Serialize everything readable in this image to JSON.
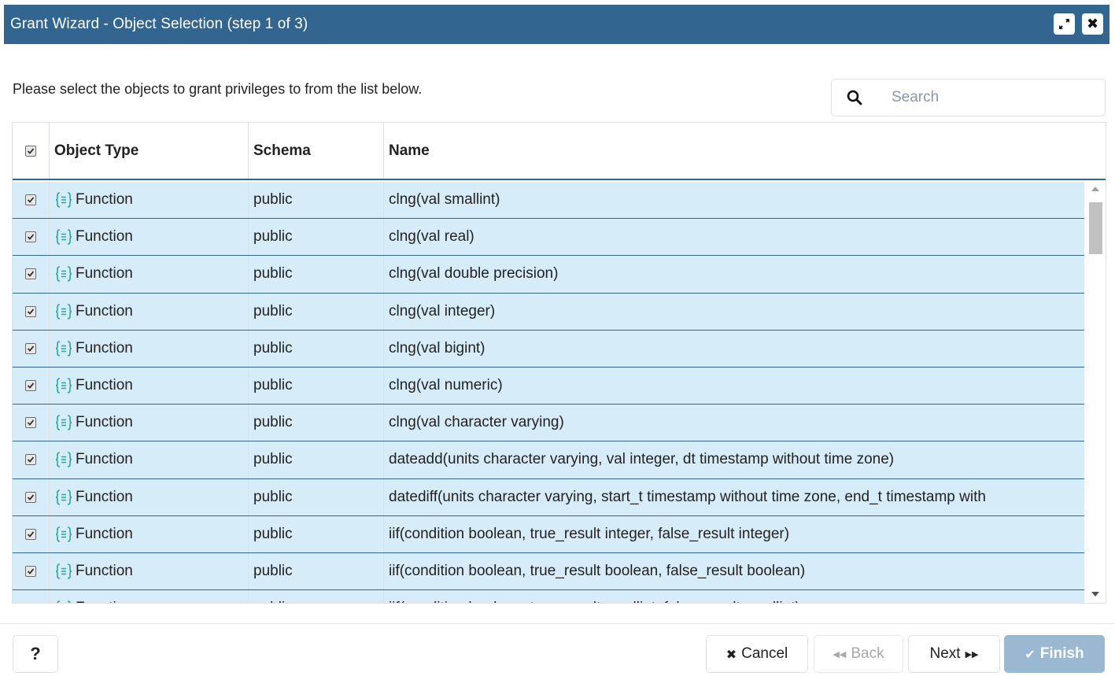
{
  "window": {
    "title": "Grant Wizard - Object Selection (step 1 of 3)",
    "maximize_icon": "maximize-icon",
    "close_icon": "close-icon",
    "close_glyph": "✖"
  },
  "instruction": "Please select the objects to grant privileges to from the list below.",
  "search": {
    "placeholder": "Search",
    "value": "",
    "icon": "search-icon"
  },
  "grid": {
    "header_checked": true,
    "columns": [
      "Object Type",
      "Schema",
      "Name"
    ],
    "rows": [
      {
        "checked": true,
        "type": "Function",
        "schema": "public",
        "name": "clng(val smallint)"
      },
      {
        "checked": true,
        "type": "Function",
        "schema": "public",
        "name": "clng(val real)"
      },
      {
        "checked": true,
        "type": "Function",
        "schema": "public",
        "name": "clng(val double precision)"
      },
      {
        "checked": true,
        "type": "Function",
        "schema": "public",
        "name": "clng(val integer)"
      },
      {
        "checked": true,
        "type": "Function",
        "schema": "public",
        "name": "clng(val bigint)"
      },
      {
        "checked": true,
        "type": "Function",
        "schema": "public",
        "name": "clng(val numeric)"
      },
      {
        "checked": true,
        "type": "Function",
        "schema": "public",
        "name": "clng(val character varying)"
      },
      {
        "checked": true,
        "type": "Function",
        "schema": "public",
        "name": "dateadd(units character varying, val integer, dt timestamp without time zone)"
      },
      {
        "checked": true,
        "type": "Function",
        "schema": "public",
        "name": "datediff(units character varying, start_t timestamp without time zone, end_t timestamp with"
      },
      {
        "checked": true,
        "type": "Function",
        "schema": "public",
        "name": "iif(condition boolean, true_result integer, false_result integer)"
      },
      {
        "checked": true,
        "type": "Function",
        "schema": "public",
        "name": "iif(condition boolean, true_result boolean, false_result boolean)"
      },
      {
        "checked": true,
        "type": "Function",
        "schema": "public",
        "name": "iif(condition boolean, true_result smallint, false_result smallint)"
      }
    ]
  },
  "footer": {
    "help_label": "?",
    "cancel_label": "Cancel",
    "cancel_glyph": "✖",
    "back_label": "Back",
    "back_glyph": "◀◀",
    "next_label": "Next",
    "next_glyph": "▶▶",
    "finish_label": "Finish",
    "finish_glyph": "✔"
  },
  "colors": {
    "titlebar": "#326690",
    "row_selected": "#d6ecf8",
    "function_icon": "#2aa5a0",
    "finish_disabled": "#9ab8d1"
  }
}
